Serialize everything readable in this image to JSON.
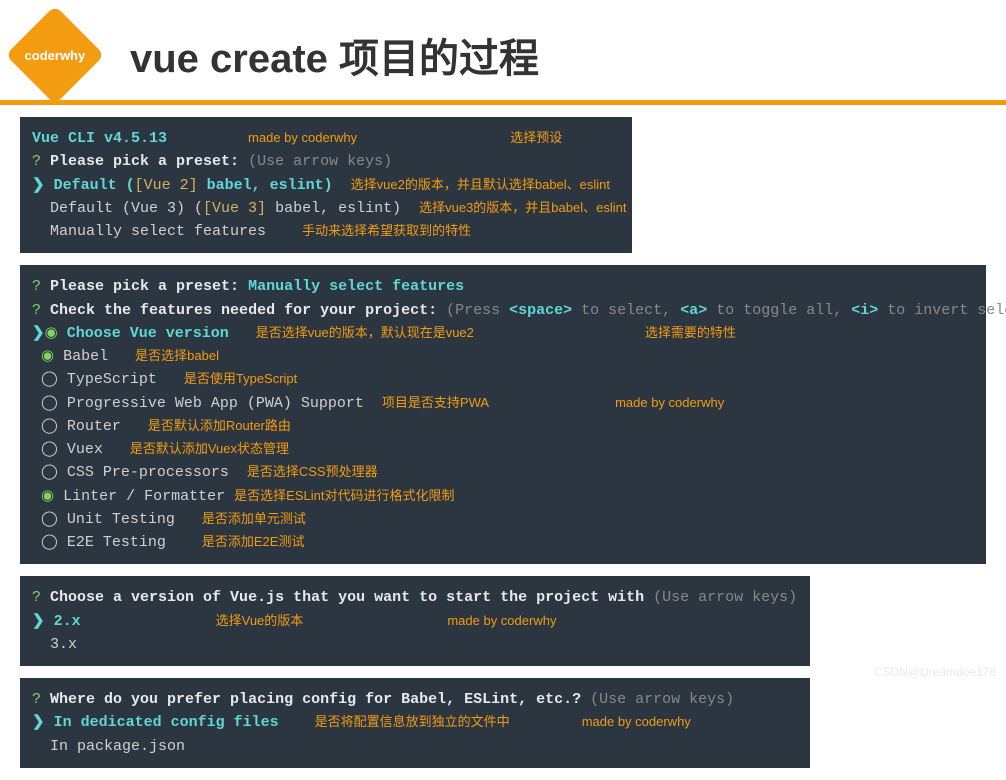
{
  "header": {
    "logo": "coderwhy",
    "title": "vue create 项目的过程"
  },
  "term1": {
    "version": "Vue CLI v4.5.13",
    "credit": "made by coderwhy",
    "section_label": "选择预设",
    "q": "?",
    "prompt": "Please pick a preset:",
    "hint": "(Use arrow keys)",
    "arrow": "❯",
    "opt1_a": "Default (",
    "opt1_b": "[Vue 2]",
    "opt1_c": " babel, eslint)",
    "note1": "选择vue2的版本，并且默认选择babel、eslint",
    "opt2_a": "Default (Vue 3) (",
    "opt2_b": "[Vue 3]",
    "opt2_c": " babel, eslint)",
    "note2": "选择vue3的版本，并且babel、eslint",
    "opt3": "Manually select features",
    "note3": "手动来选择希望获取到的特性"
  },
  "term2": {
    "prompt1": "Please pick a preset:",
    "ans1": "Manually select features",
    "prompt2": "Check the features needed for your project:",
    "hint2a": "(Press ",
    "space": "<space>",
    "hint2b": " to select, ",
    "a": "<a>",
    "hint2c": " to toggle all, ",
    "i": "<i>",
    "hint2d": " to invert selection)",
    "arrow": "❯",
    "sel": "◉",
    "unsel": "◯",
    "f1": "Choose Vue version",
    "n1": "是否选择vue的版本，默认现在是vue2",
    "f2": "Babel",
    "n2": "是否选择babel",
    "f3": "TypeScript",
    "n3": "是否使用TypeScript",
    "f4": "Progressive Web App (PWA) Support",
    "n4": "项目是否支持PWA",
    "f5": "Router",
    "n5": "是否默认添加Router路由",
    "f6": "Vuex",
    "n6": "是否默认添加Vuex状态管理",
    "f7": "CSS Pre-processors",
    "n7": "是否选择CSS预处理器",
    "f8": "Linter / Formatter",
    "n8": "是否选择ESLint对代码进行格式化限制",
    "f9": "Unit Testing",
    "n9": "是否添加单元测试",
    "f10": "E2E Testing",
    "n10": "是否添加E2E测试",
    "section_label": "选择需要的特性",
    "credit": "made by coderwhy"
  },
  "term3": {
    "prompt": "Choose a version of Vue.js that you want to start the project with",
    "hint": "(Use arrow keys)",
    "arrow": "❯",
    "opt1": "2.x",
    "opt2": "3.x",
    "section_label": "选择Vue的版本",
    "credit": "made by coderwhy"
  },
  "term4": {
    "prompt": "Where do you prefer placing config for Babel, ESLint, etc.?",
    "hint": "(Use arrow keys)",
    "arrow": "❯",
    "opt1": "In dedicated config files",
    "opt2": "In package.json",
    "note": "是否将配置信息放到独立的文件中",
    "credit": "made by coderwhy"
  },
  "watermark": "CSDN@Dreamdoe176"
}
